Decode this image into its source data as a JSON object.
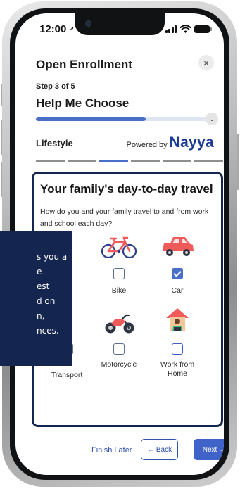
{
  "status_bar": {
    "time": "12:00",
    "location_glyph": "➚"
  },
  "header": {
    "title": "Open Enrollment",
    "close_glyph": "×"
  },
  "step": {
    "label": "Step 3 of 5",
    "title": "Help Me Choose",
    "progress": 0.61,
    "toggle_glyph": "⌄"
  },
  "section": {
    "label": "Lifestyle",
    "powered_by": "Powered by",
    "brand": "Nayya",
    "segments_total": 6,
    "segments_active_index": 2
  },
  "question": {
    "title": "Your family's day-to-day travel",
    "body": "How do you and your family travel to and from work and school each day?",
    "options": [
      {
        "label": "Bike",
        "checked": false,
        "icon": "bicycle-icon"
      },
      {
        "label": "Car",
        "checked": true,
        "icon": "car-icon"
      },
      {
        "label": "Transport",
        "checked": false,
        "icon": "transport-icon"
      },
      {
        "label": "Motorcycle",
        "checked": false,
        "icon": "motorcycle-icon"
      },
      {
        "label": "Work from Home",
        "checked": false,
        "icon": "house-icon"
      }
    ]
  },
  "tooltip": {
    "lines": [
      "s you a",
      "e",
      "est",
      "d on",
      "n,",
      "nces."
    ]
  },
  "footer": {
    "finish_later": "Finish Later",
    "back": "Back",
    "back_glyph": "←",
    "next": "Next",
    "next_glyph": "→"
  },
  "colors": {
    "accent": "#4a6fc8",
    "brand": "#1b3a94",
    "navy": "#14254f",
    "car_red": "#f05a5a"
  }
}
